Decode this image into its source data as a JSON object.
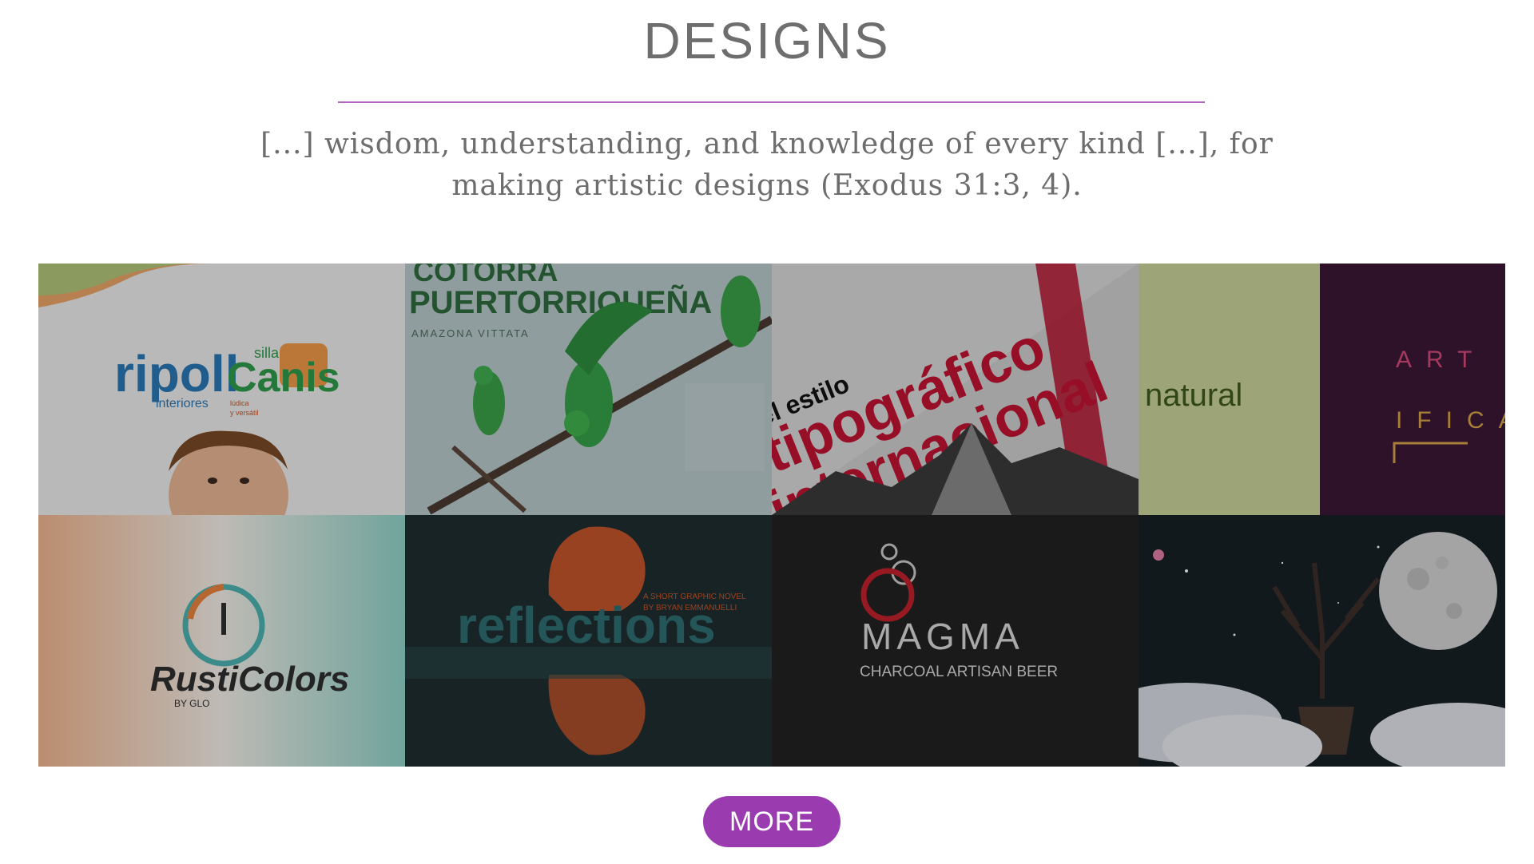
{
  "section": {
    "title": "DESIGNS",
    "quote_line1": "[...] wisdom, understanding, and knowledge of every kind [...], for",
    "quote_line2": "making artistic designs (Exodus 31:3, 4)."
  },
  "colors": {
    "accent": "#9b3bb0",
    "divider": "#b265c5",
    "title": "#6e6e6e"
  },
  "gallery": {
    "tiles": [
      {
        "name": "ripoll-silla-canis",
        "texts": {
          "ripoll": "ripoll",
          "interiores": "interiores",
          "silla": "silla",
          "canis": "Canis",
          "canis_sub1": "lúdica",
          "canis_sub2": "y versátil"
        }
      },
      {
        "name": "cotorra-puertorriquena",
        "texts": {
          "heading1": "COTORRA",
          "heading2": "PUERTORRIQUEÑA",
          "sub": "AMAZONA VITTATA"
        }
      },
      {
        "name": "estilo-tipografico",
        "texts": {
          "line1": "el estilo",
          "line2": "tipográfico",
          "line3": "internacional"
        }
      },
      {
        "name": "natural-artifica",
        "texts": {
          "natural": "natural",
          "art": "ART",
          "ifica": "IFICA"
        }
      },
      {
        "name": "rusticolors",
        "texts": {
          "brand": "RustiColors",
          "by": "BY GLO"
        }
      },
      {
        "name": "reflections",
        "texts": {
          "title": "reflections",
          "sub1": "A SHORT GRAPHIC NOVEL",
          "sub2": "BY BRYAN EMMANUELLI"
        }
      },
      {
        "name": "magma",
        "texts": {
          "brand": "MAGMA",
          "sub": "CHARCOAL ARTISAN BEER"
        }
      },
      {
        "name": "moon-tree",
        "texts": {}
      }
    ]
  },
  "buttons": {
    "more": "MORE"
  }
}
